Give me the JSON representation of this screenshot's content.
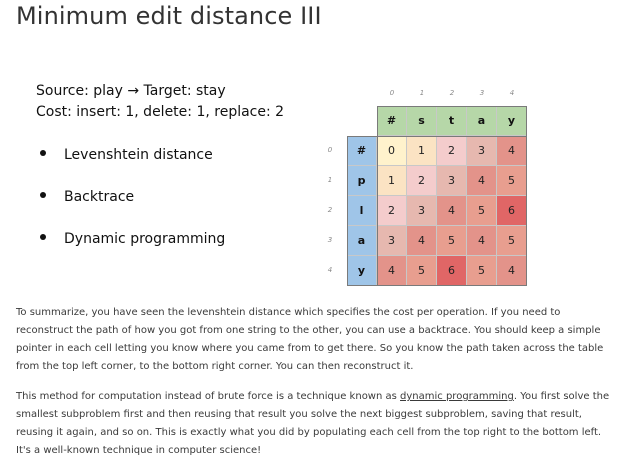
{
  "title": "Minimum edit distance III",
  "source_line": "Source: play → Target: stay",
  "cost_line": "Cost: insert: 1,  delete: 1, replace: 2",
  "bullets": [
    "Levenshtein distance",
    "Backtrace",
    "Dynamic programming"
  ],
  "matrix": {
    "col_indices": [
      "0",
      "1",
      "2",
      "3",
      "4"
    ],
    "row_indices": [
      "0",
      "1",
      "2",
      "3",
      "4"
    ],
    "col_headers": [
      "#",
      "s",
      "t",
      "a",
      "y"
    ],
    "row_headers": [
      "#",
      "p",
      "l",
      "a",
      "y"
    ],
    "values": [
      [
        0,
        1,
        2,
        3,
        4
      ],
      [
        1,
        2,
        3,
        4,
        5
      ],
      [
        2,
        3,
        4,
        5,
        6
      ],
      [
        3,
        4,
        5,
        4,
        5
      ],
      [
        4,
        5,
        6,
        5,
        4
      ]
    ],
    "colors": {
      "col_header_bg": "#b6d7a8",
      "row_header_bg": "#9fc5e8",
      "value_scale": [
        "#fff2cc",
        "#fbe3c3",
        "#f4cccc",
        "#e6b8af",
        "#e3938a",
        "#e89e8f",
        "#e06666"
      ]
    }
  },
  "paragraph1": "To summarize, you have seen the levenshtein distance which specifies the cost per operation. If you need to reconstruct the path of how you got from one string to the other, you can use a backtrace. You should keep a simple pointer in each cell letting you know where you came from to get there. So you know the path taken across the table from the top left corner, to the bottom right corner. You can then reconstruct it.",
  "paragraph2_before": "This method for computation instead of brute force is a technique known as ",
  "paragraph2_link": "dynamic programming",
  "paragraph2_after": ". You first solve the smallest subproblem first and then reusing that result you solve the next biggest subproblem, saving that result, reusing it again, and so on. This is exactly what you did by populating each cell from the top right to the bottom left. It's a well-known technique in computer science!"
}
